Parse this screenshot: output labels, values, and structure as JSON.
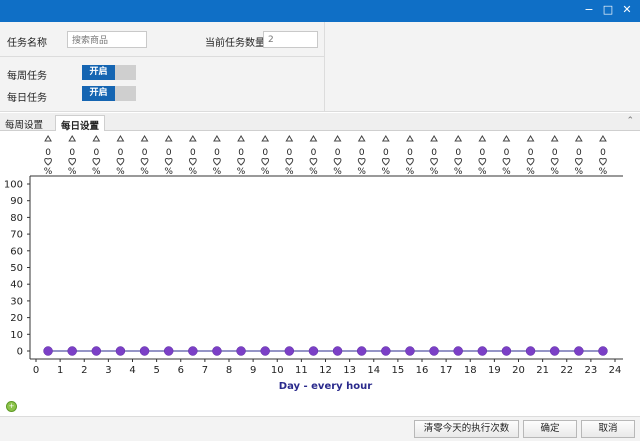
{
  "window": {
    "minimize_glyph": "−",
    "maximize_glyph": "□",
    "close_glyph": "✕"
  },
  "form": {
    "task_name_label": "任务名称",
    "task_name_value": "搜索商品",
    "task_count_label": "当前任务数量",
    "task_count_value": "2",
    "weekly_label": "每周任务",
    "weekly_toggle": "开启",
    "daily_label": "每日任务",
    "daily_toggle": "开启"
  },
  "tabs": [
    {
      "label": "每周设置",
      "active": false
    },
    {
      "label": "每日设置",
      "active": true
    }
  ],
  "chart_data": {
    "type": "line",
    "xlabel": "Day - every hour",
    "ylabel": "",
    "xlim": [
      0,
      24
    ],
    "ylim": [
      0,
      100
    ],
    "x_ticks": [
      0,
      1,
      2,
      3,
      4,
      5,
      6,
      7,
      8,
      9,
      10,
      11,
      12,
      13,
      14,
      15,
      16,
      17,
      18,
      19,
      20,
      21,
      22,
      23,
      24
    ],
    "y_ticks": [
      0,
      10,
      20,
      30,
      40,
      50,
      60,
      70,
      80,
      90,
      100
    ],
    "series": [
      {
        "x": [
          0.5,
          1.5,
          2.5,
          3.5,
          4.5,
          5.5,
          6.5,
          7.5,
          8.5,
          9.5,
          10.5,
          11.5,
          12.5,
          13.5,
          14.5,
          15.5,
          16.5,
          17.5,
          18.5,
          19.5,
          20.5,
          21.5,
          22.5,
          23.5
        ],
        "values": [
          0,
          0,
          0,
          0,
          0,
          0,
          0,
          0,
          0,
          0,
          0,
          0,
          0,
          0,
          0,
          0,
          0,
          0,
          0,
          0,
          0,
          0,
          0,
          0
        ],
        "color": "#7b3fc6"
      }
    ],
    "top_labels": [
      "0",
      "0",
      "0",
      "0",
      "0",
      "0",
      "0",
      "0",
      "0",
      "0",
      "0",
      "0",
      "0",
      "0",
      "0",
      "0",
      "0",
      "0",
      "0",
      "0",
      "0",
      "0",
      "0",
      "0"
    ],
    "top_label_unit": "%",
    "grid": false,
    "line_color": "#2a2a8c"
  },
  "footer": {
    "clear_button": "清零今天的执行次数",
    "ok_button": "确定",
    "cancel_button": "取消"
  }
}
